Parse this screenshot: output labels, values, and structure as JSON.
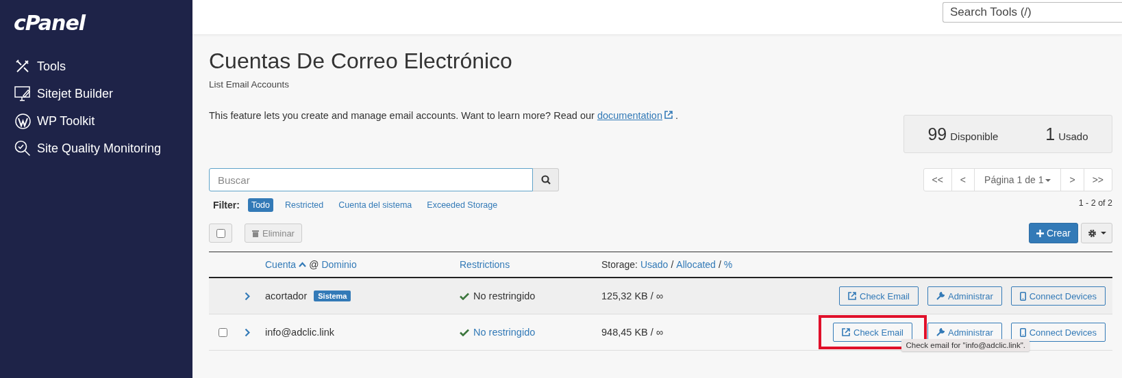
{
  "logo": "cPanel",
  "sidebar": {
    "items": [
      {
        "label": "Tools",
        "kind": "tools"
      },
      {
        "label": "Sitejet Builder",
        "kind": "monitor"
      },
      {
        "label": "WP Toolkit",
        "kind": "wordpress"
      },
      {
        "label": "Site Quality Monitoring",
        "kind": "magnifier"
      }
    ]
  },
  "topbar": {
    "search_placeholder": "Search Tools (/)"
  },
  "page": {
    "title": "Cuentas De Correo Electrónico",
    "subtitle": "List Email Accounts",
    "description": "This feature lets you create and manage email accounts. Want to learn more? Read our",
    "link": "documentation",
    "after_link": "."
  },
  "stats": [
    {
      "value": "99",
      "label": "Disponible"
    },
    {
      "value": "1",
      "label": "Usado"
    }
  ],
  "search": {
    "placeholder": "Buscar"
  },
  "pagination": {
    "first": "<<",
    "prev": "<",
    "page": "Página 1 de 1",
    "next": ">",
    "last": ">>",
    "range": "1 - 2 of 2"
  },
  "filter": {
    "label": "Filter:",
    "options": [
      {
        "label": "Todo",
        "selected": true
      },
      {
        "label": "Restricted",
        "selected": false
      },
      {
        "label": "Cuenta del sistema",
        "selected": false
      },
      {
        "label": "Exceeded Storage",
        "selected": false
      }
    ]
  },
  "toolbar": {
    "select_all_checked": false,
    "delete": {
      "label": "Eliminar",
      "disabled": true
    },
    "create": "Crear"
  },
  "table": {
    "header": {
      "account": [
        {
          "text": "Cuenta",
          "kind": "link"
        },
        {
          "text": "@",
          "kind": "plain"
        },
        {
          "text": "Dominio",
          "kind": "link"
        }
      ],
      "restrictions": "Restrictions",
      "storage": [
        {
          "text": "Storage:",
          "kind": "plain"
        },
        {
          "text": "Usado",
          "kind": "link"
        },
        {
          "text": "/",
          "kind": "plain"
        },
        {
          "text": "Allocated",
          "kind": "link"
        },
        {
          "text": "/",
          "kind": "plain"
        },
        {
          "text": "%",
          "kind": "link"
        }
      ]
    },
    "rows": [
      {
        "account": "acortador",
        "badge": "Sistema",
        "shaded": true,
        "restriction": "No restringido",
        "restriction_link": false,
        "storage": "125,32 KB / ∞",
        "actions": [
          {
            "kind": "check",
            "label": "Check Email",
            "highlighted": false
          },
          {
            "kind": "manage",
            "label": "Administrar",
            "highlighted": false
          },
          {
            "kind": "devices",
            "label": "Connect Devices",
            "highlighted": false
          }
        ]
      },
      {
        "account": "info@adclic.link",
        "checked": false,
        "shaded": false,
        "restriction": "No restringido",
        "restriction_link": true,
        "storage": "948,45 KB / ∞",
        "actions": [
          {
            "kind": "check",
            "label": "Check Email",
            "highlighted": true
          },
          {
            "kind": "manage",
            "label": "Administrar",
            "highlighted": false
          },
          {
            "kind": "devices",
            "label": "Connect Devices",
            "highlighted": false
          }
        ]
      }
    ]
  },
  "tooltip": "Check email for \"info@adclic.link\"."
}
